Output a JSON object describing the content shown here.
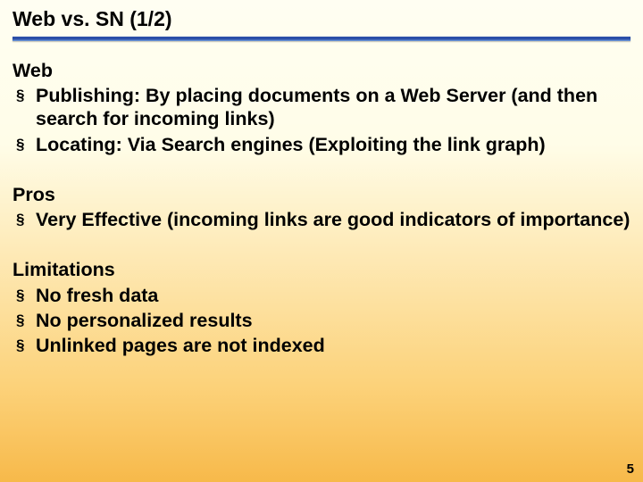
{
  "title": "Web vs. SN (1/2)",
  "sections": [
    {
      "heading": "Web",
      "bullets": [
        "Publishing: By placing documents on a Web Server (and then search for incoming links)",
        "Locating: Via Search engines (Exploiting the link graph)"
      ]
    },
    {
      "heading": "Pros",
      "bullets": [
        "Very Effective (incoming links are good indicators of importance)"
      ]
    },
    {
      "heading": "Limitations",
      "bullets": [
        "No fresh data",
        "No personalized results",
        "Unlinked pages are not indexed"
      ]
    }
  ],
  "page_number": "5"
}
